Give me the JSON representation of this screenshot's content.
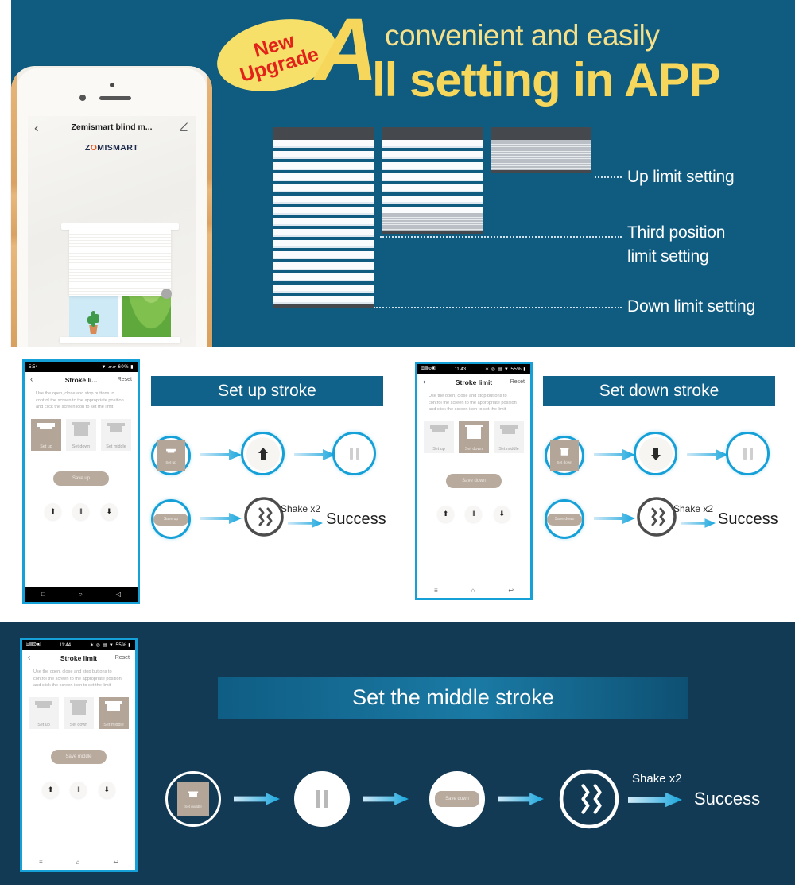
{
  "hero": {
    "badge_line1": "New",
    "badge_line2": "Upgrade",
    "big_letter": "A",
    "subtitle": "convenient and easily",
    "title": "ll setting in APP",
    "phone": {
      "title": "Zemismart blind m...",
      "brand_pre": "Z",
      "brand_o": "O",
      "brand_post": "MISMART",
      "back_icon": "chevron-left-icon",
      "edit_icon": "edit-pencil-icon"
    },
    "limits": [
      {
        "label": "Up limit setting"
      },
      {
        "label": "Third position"
      },
      {
        "label": "limit setting"
      },
      {
        "label": "Down limit setting"
      }
    ]
  },
  "phone_common": {
    "back": "‹",
    "reset": "Reset",
    "description": "Use the open, close and stop buttons to control the screen to the appropriate position and click the screen icon to set the limit",
    "tiles": [
      {
        "cap": "Set up"
      },
      {
        "cap": "Set down"
      },
      {
        "cap": "Set middle"
      }
    ],
    "controls": [
      {
        "icon": "arrow-up-icon",
        "glyph": "⬆"
      },
      {
        "icon": "pause-icon",
        "glyph": "‖"
      },
      {
        "icon": "arrow-down-icon",
        "glyph": "⬇"
      }
    ],
    "nav": [
      {
        "icon": "recents-icon",
        "glyph": "□"
      },
      {
        "icon": "home-icon",
        "glyph": "○"
      },
      {
        "icon": "back-icon",
        "glyph": "◁"
      }
    ],
    "nav_light": [
      {
        "icon": "menu-icon",
        "glyph": "≡"
      },
      {
        "icon": "home-icon",
        "glyph": "⌂"
      },
      {
        "icon": "back-icon",
        "glyph": "↩"
      }
    ]
  },
  "section_up": {
    "banner": "Set up stroke",
    "phone": {
      "status_time": "5:54",
      "status_right": "▼ ▰▰ 60% ▮",
      "title": "Stroke li...",
      "save_label": "Save up",
      "active_tile": 0
    },
    "flow_row1": [
      {
        "type": "tile",
        "cap": "Set up"
      },
      {
        "type": "arrow-up"
      },
      {
        "type": "pause"
      }
    ],
    "flow_row2": [
      {
        "type": "pill",
        "label": "Save up"
      },
      {
        "type": "shake"
      }
    ],
    "shake_label": "Shake x2",
    "success": "Success"
  },
  "section_down": {
    "banner": "Set down stroke",
    "phone": {
      "status_time": "11:43",
      "status_left": "⌸▤⚙▣",
      "status_right": "✶ ◎ ▤ ▼ 55% ▮",
      "title": "Stroke limit",
      "save_label": "Save down",
      "active_tile": 1
    },
    "flow_row1": [
      {
        "type": "tile",
        "cap": "Set down"
      },
      {
        "type": "arrow-down"
      },
      {
        "type": "pause"
      }
    ],
    "flow_row2": [
      {
        "type": "pill",
        "label": "Save down"
      },
      {
        "type": "shake"
      }
    ],
    "shake_label": "Shake x2",
    "success": "Success"
  },
  "section_middle": {
    "banner": "Set the middle stroke",
    "phone": {
      "status_time": "11:44",
      "status_left": "⌸▤⚙▣",
      "status_right": "✶ ◎ ▤ ▼ 55% ▮",
      "title": "Stroke limit",
      "save_label": "Save middle",
      "active_tile": 2
    },
    "flow": [
      {
        "type": "tile",
        "cap": "Set middle"
      },
      {
        "type": "pause"
      },
      {
        "type": "pill",
        "label": "Save down"
      },
      {
        "type": "shake"
      }
    ],
    "shake_label": "Shake x2",
    "success": "Success"
  },
  "colors": {
    "hero_bg": "#0f5c80",
    "bottom_bg": "#123a55",
    "accent_cyan": "#16a0d8",
    "yellow": "#f6d75b",
    "badge_yellow": "#f7e06a",
    "badge_red": "#e2231a",
    "banner_blue": "#10628a",
    "tile_active": "#b3a598"
  }
}
